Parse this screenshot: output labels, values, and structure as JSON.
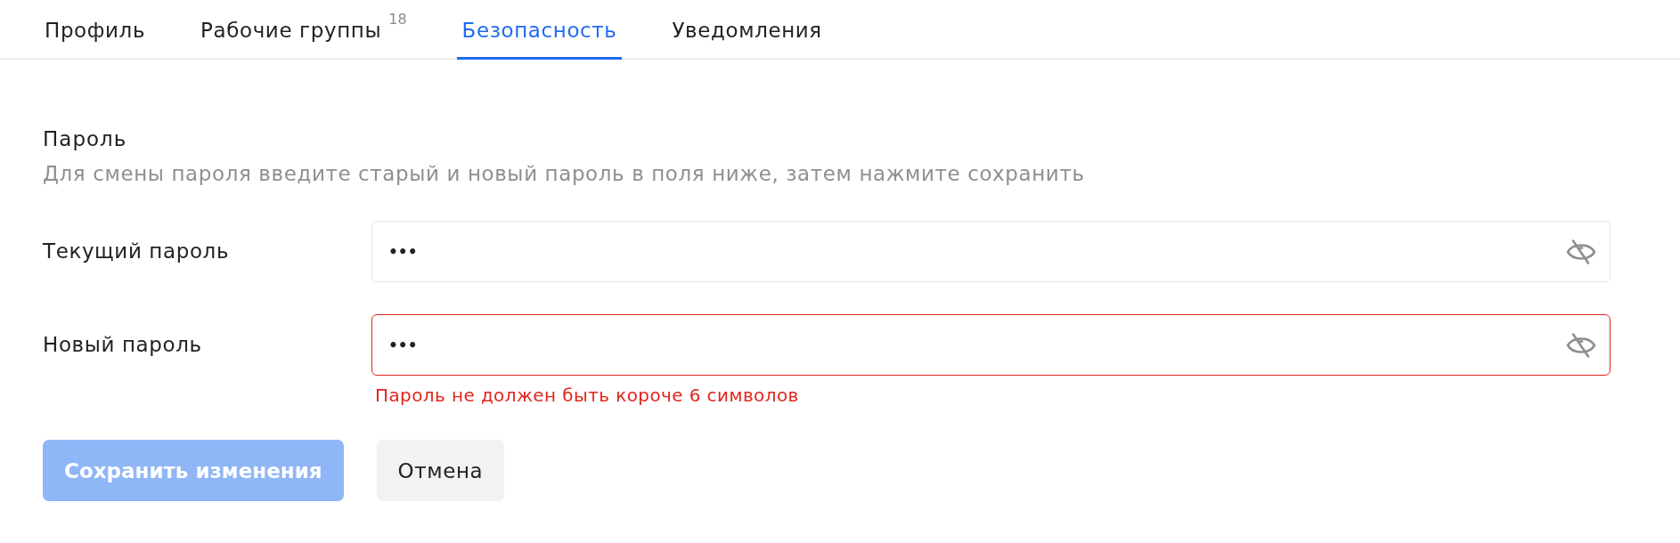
{
  "tabs": [
    {
      "label": "Профиль",
      "selected": false
    },
    {
      "label": "Рабочие группы",
      "count": "18",
      "selected": false
    },
    {
      "label": "Безопасность",
      "selected": true
    },
    {
      "label": "Уведомления",
      "selected": false
    }
  ],
  "section": {
    "title": "Пароль",
    "description": "Для смены пароля введите старый и новый пароль в поля ниже, затем нажмите сохранить"
  },
  "fields": [
    {
      "label": "Текущий пароль",
      "value": "•••",
      "revealed": false,
      "invalid": false
    },
    {
      "label": "Новый пароль",
      "value": "•••",
      "revealed": false,
      "invalid": true,
      "error": "Пароль не должен быть короче 6 символов"
    }
  ],
  "buttons": [
    {
      "kind": "primary",
      "label": "Сохранить изменения",
      "disabled": true
    },
    {
      "kind": "secondary",
      "label": "Отмена"
    }
  ]
}
